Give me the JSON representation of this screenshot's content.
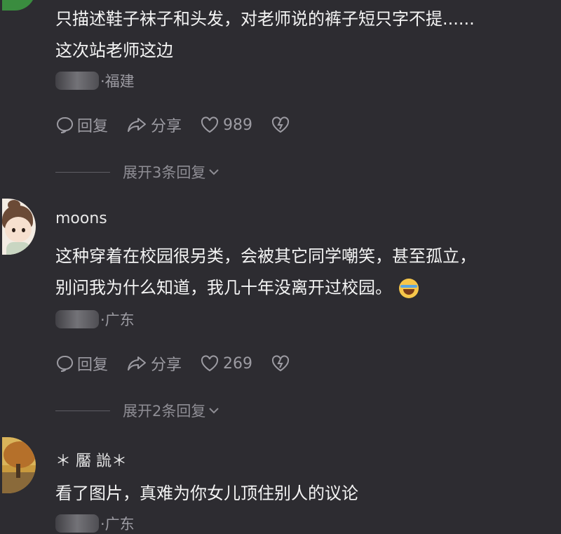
{
  "comments": [
    {
      "text_lines": [
        "只描述鞋子袜子和头发，对老师说的裤子短只字不提......",
        "这次站老师这边"
      ],
      "location": "·福建",
      "actions": {
        "reply": "回复",
        "share": "分享",
        "likes": "989"
      },
      "expand": "展开3条回复"
    },
    {
      "name": "moons",
      "text_lines": [
        "这种穿着在校园很另类，会被其它同学嘲笑，甚至孤立，",
        "别问我为什么知道，我几十年没离开过校园。"
      ],
      "location": "·广东",
      "actions": {
        "reply": "回复",
        "share": "分享",
        "likes": "269"
      },
      "expand": "展开2条回复"
    },
    {
      "name": "＊ 靨 詤＊",
      "text_lines": [
        "看了图片，真难为你女儿顶住别人的议论"
      ],
      "location": "·广东"
    }
  ],
  "colors": {
    "background": "#2d2c31",
    "text": "#f4f4f4",
    "muted": "#9c9ba2"
  },
  "icons": [
    "comment-icon",
    "share-icon",
    "heart-icon",
    "broken-heart-icon",
    "chevron-down-icon",
    "laughing-crying-emoji"
  ]
}
